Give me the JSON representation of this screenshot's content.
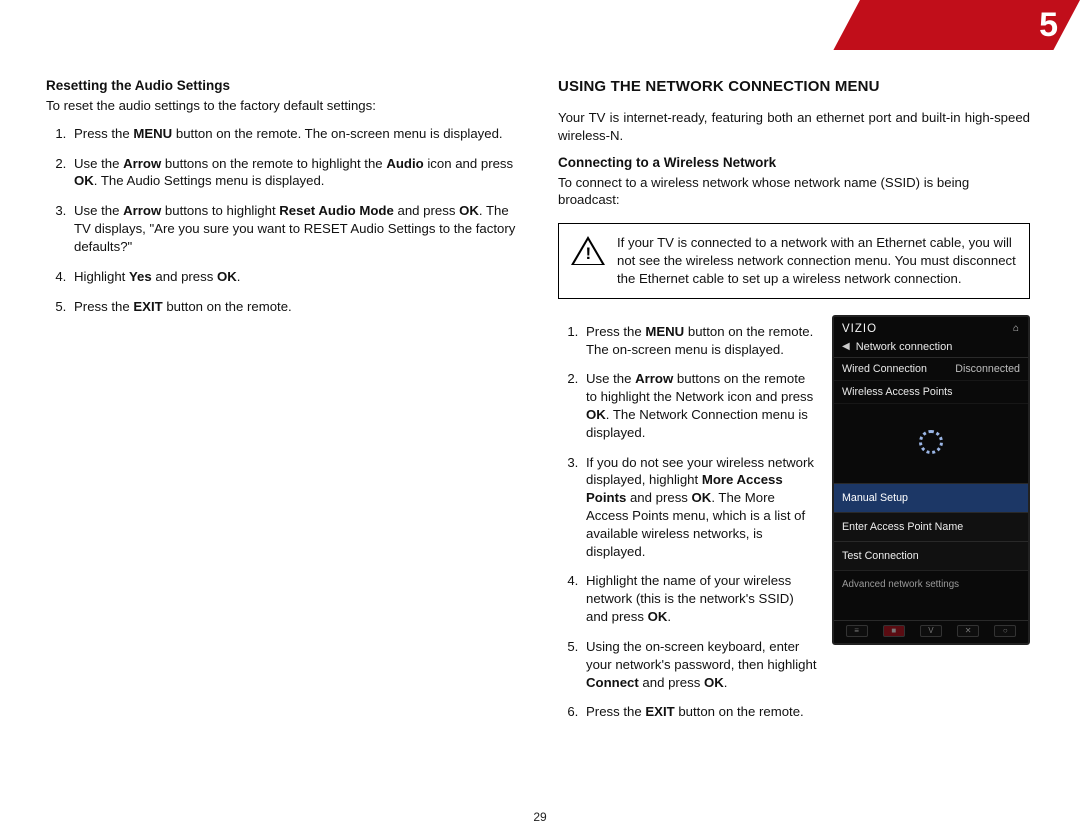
{
  "chapter_number": "5",
  "page_number": "29",
  "left": {
    "subhead": "Resetting the Audio Settings",
    "intro": "To reset the audio settings to the factory default settings:",
    "steps": [
      {
        "pre": "Press the ",
        "b1": "MENU",
        "mid": " button on the remote. The on-screen menu is displayed."
      },
      {
        "pre": "Use the ",
        "b1": "Arrow",
        "mid": " buttons on the remote to highlight the ",
        "b2": "Audio",
        "post": " icon and press ",
        "b3": "OK",
        "tail": ". The Audio Settings menu is displayed."
      },
      {
        "pre": "Use the ",
        "b1": "Arrow",
        "mid": " buttons to highlight ",
        "b2": "Reset Audio Mode",
        "post": " and press ",
        "b3": "OK",
        "tail": ". The TV displays, \"Are you sure you want to RESET Audio Settings to the factory defaults?\""
      },
      {
        "pre": "Highlight ",
        "b1": "Yes",
        "mid": " and press ",
        "b2": "OK",
        "post": "."
      },
      {
        "pre": "Press the ",
        "b1": "EXIT",
        "mid": " button on the remote."
      }
    ]
  },
  "right": {
    "title": "USING THE NETWORK CONNECTION MENU",
    "intro": "Your TV is internet-ready, featuring both an ethernet port and built-in high-speed wireless-N.",
    "subhead": "Connecting to a Wireless Network",
    "lead": "To connect to a wireless network whose network name (SSID) is being broadcast:",
    "callout": "If your TV is connected to a network with an Ethernet cable, you will not see the wireless network connection menu. You must disconnect the Ethernet cable to set up a wireless network connection.",
    "steps": [
      {
        "pre": "Press the ",
        "b1": "MENU",
        "mid": " button on the remote. The on-screen menu is displayed."
      },
      {
        "pre": "Use the ",
        "b1": "Arrow",
        "mid": " buttons on the remote to highlight the Network icon and press ",
        "b2": "OK",
        "post": ". The Network Connection menu is displayed."
      },
      {
        "pre": "If you do not see your wireless network displayed, highlight ",
        "b1": "More Access Points",
        "mid": " and press ",
        "b2": "OK",
        "post": ". The More Access Points menu, which is a list of available wireless networks, is displayed."
      },
      {
        "pre": "Highlight the name of your wireless network (this is the network's SSID) and press ",
        "b1": "OK",
        "mid": "."
      },
      {
        "pre": "Using the on-screen keyboard, enter your network's password, then highlight ",
        "b1": "Connect",
        "mid": " and press ",
        "b2": "OK",
        "post": "."
      },
      {
        "pre": "Press the ",
        "b1": "EXIT",
        "mid": " button on the remote."
      }
    ]
  },
  "tv": {
    "brand": "VIZIO",
    "screen_title": "Network connection",
    "row1_label": "Wired Connection",
    "row1_value": "Disconnected",
    "row2_label": "Wireless Access Points",
    "manual": "Manual Setup",
    "enter_ap": "Enter Access Point Name",
    "test": "Test Connection",
    "advanced": "Advanced network settings"
  }
}
